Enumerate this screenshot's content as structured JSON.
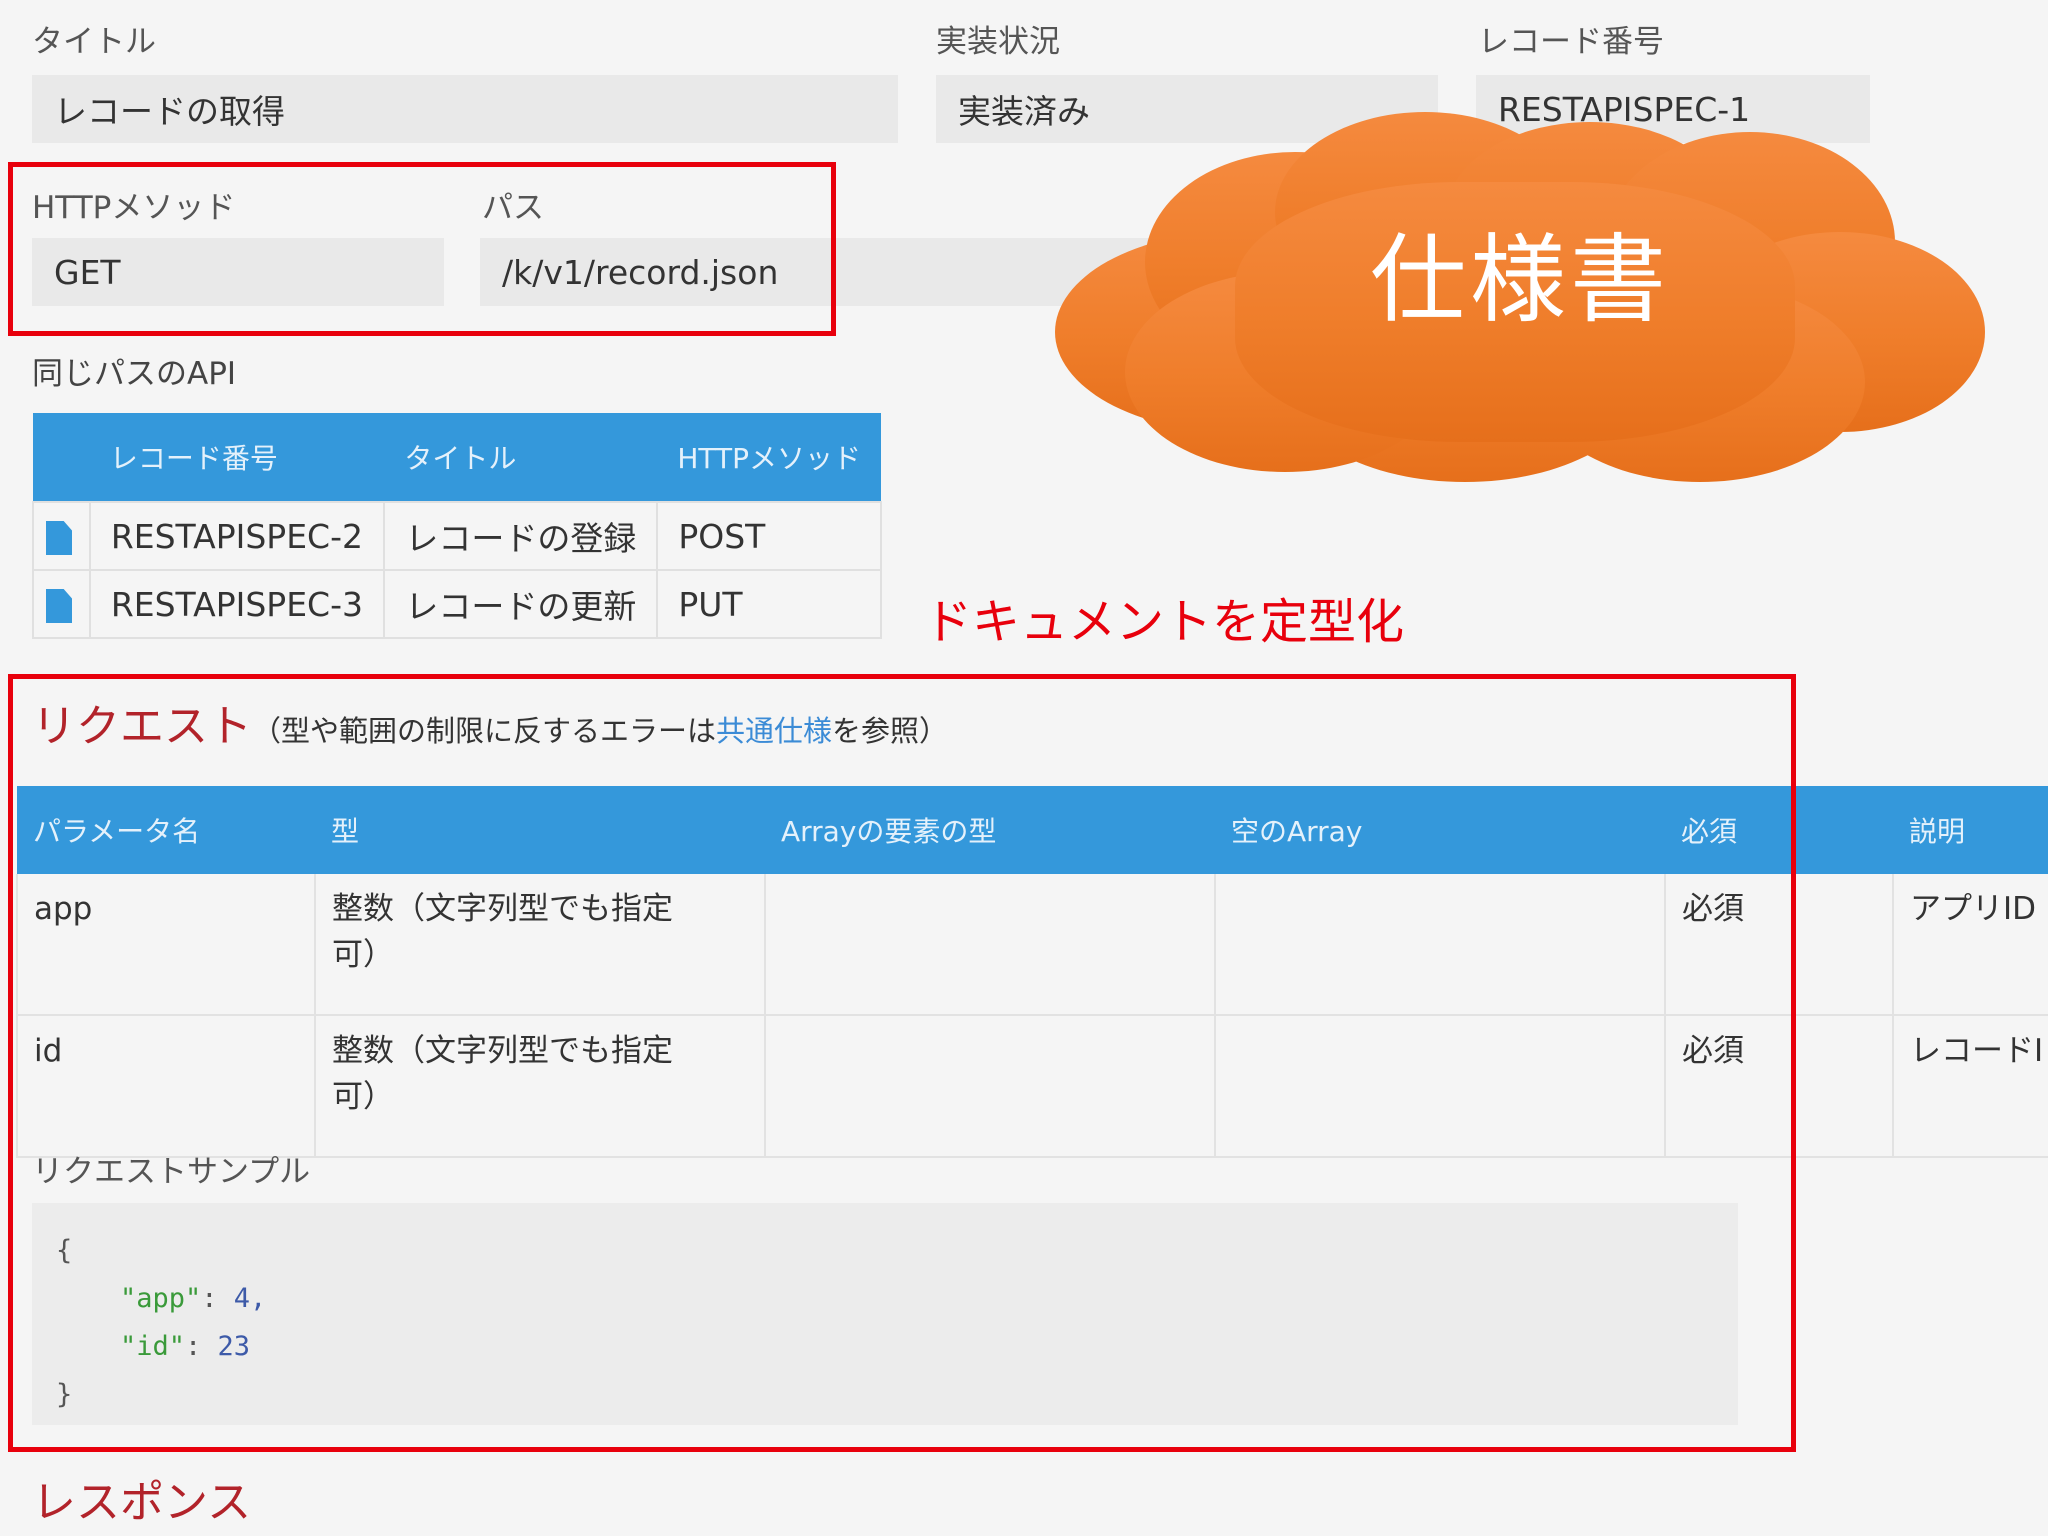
{
  "fields": {
    "title_label": "タイトル",
    "title_value": "レコードの取得",
    "status_label": "実装状況",
    "status_value": "実装済み",
    "record_label": "レコード番号",
    "record_value": "RESTAPISPEC-1",
    "method_label": "HTTPメソッド",
    "method_value": "GET",
    "path_label": "パス",
    "path_value": "/k/v1/record.json"
  },
  "same_path": {
    "heading": "同じパスのAPI",
    "headers": [
      "レコード番号",
      "タイトル",
      "HTTPメソッド"
    ],
    "rows": [
      {
        "icon": "document-icon",
        "record": "RESTAPISPEC-2",
        "title": "レコードの登録",
        "method": "POST"
      },
      {
        "icon": "document-icon",
        "record": "RESTAPISPEC-3",
        "title": "レコードの更新",
        "method": "PUT"
      }
    ]
  },
  "annotations": {
    "cloud_text": "仕様書",
    "caption": "ドキュメントを定型化"
  },
  "request": {
    "title": "リクエスト",
    "note_prefix": "（型や範囲の制限に反するエラーは",
    "note_link": "共通仕様",
    "note_suffix": "を参照）",
    "headers": [
      "パラメータ名",
      "型",
      "Arrayの要素の型",
      "空のArray",
      "必須",
      "説明"
    ],
    "rows": [
      {
        "name": "app",
        "type": "整数（文字列型でも指定可）",
        "elem_type": "",
        "empty_array": "",
        "required": "必須",
        "desc": "アプリID"
      },
      {
        "name": "id",
        "type": "整数（文字列型でも指定可）",
        "elem_type": "",
        "empty_array": "",
        "required": "必須",
        "desc": "レコードI"
      }
    ],
    "sample_heading": "リクエストサンプル",
    "sample": {
      "open": "{",
      "key1": "\"app\"",
      "val1": "4,",
      "key2": "\"id\"",
      "val2": "23",
      "close": "}"
    }
  },
  "response": {
    "title": "レスポンス"
  },
  "colors": {
    "accent": "#3498db",
    "highlight_border": "#e8000c",
    "section_title": "#b2232a",
    "cloud": "#ef7d2a"
  }
}
